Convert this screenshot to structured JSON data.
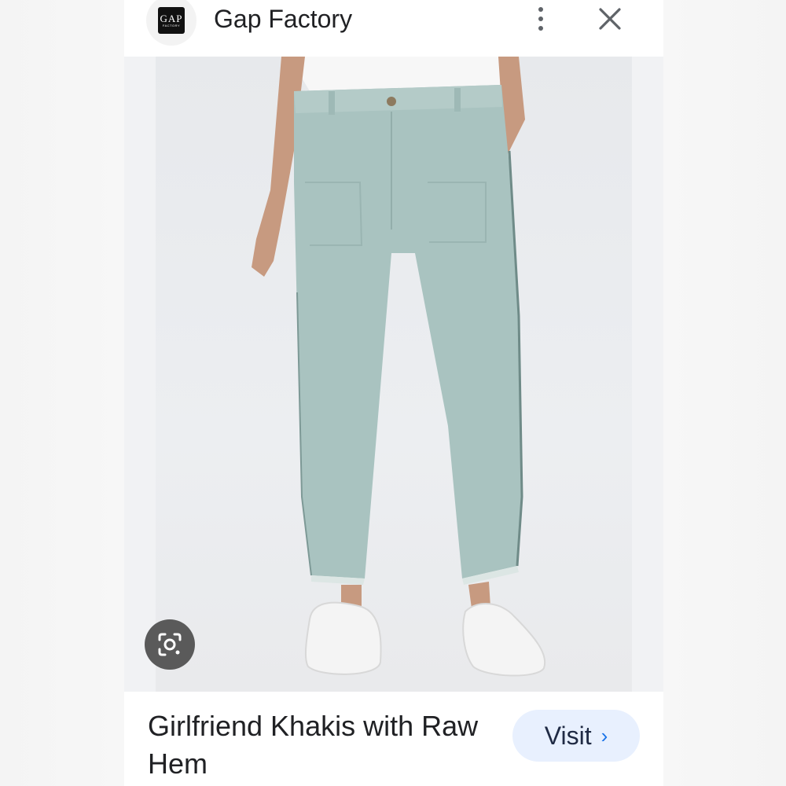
{
  "header": {
    "logo_text": "GAP",
    "logo_subtext": "FACTORY",
    "site_name": "Gap Factory",
    "menu_icon": "more-vert-icon",
    "close_icon": "close-icon"
  },
  "image": {
    "lens_icon": "google-lens-icon"
  },
  "footer": {
    "title": "Girlfriend Khakis with Raw Hem",
    "visit_label": "Visit",
    "visit_icon": "chevron-right-icon"
  },
  "colors": {
    "accent": "#1a73e8",
    "visit_bg": "#e8f0fe",
    "pants": "#a9c3c0"
  }
}
